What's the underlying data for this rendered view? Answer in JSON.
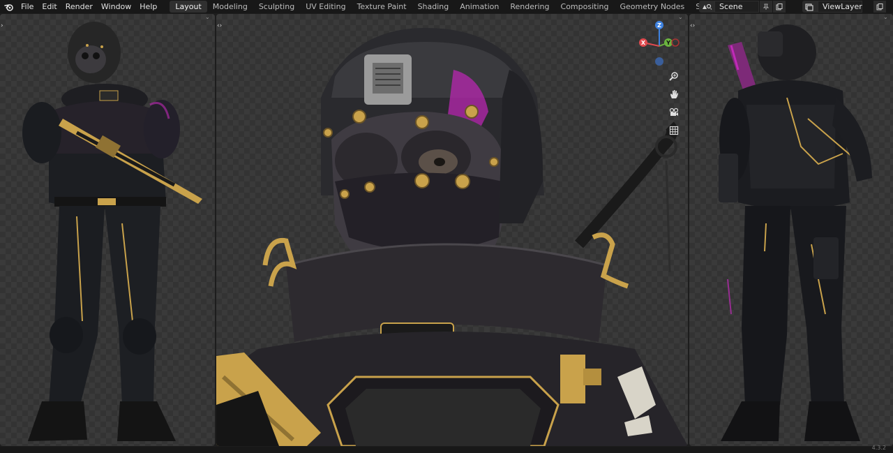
{
  "menu": [
    "File",
    "Edit",
    "Render",
    "Window",
    "Help"
  ],
  "workspaces": [
    {
      "label": "Layout",
      "active": true
    },
    {
      "label": "Modeling"
    },
    {
      "label": "Sculpting"
    },
    {
      "label": "UV Editing"
    },
    {
      "label": "Texture Paint"
    },
    {
      "label": "Shading"
    },
    {
      "label": "Animation"
    },
    {
      "label": "Rendering"
    },
    {
      "label": "Compositing"
    },
    {
      "label": "Geometry Nodes"
    },
    {
      "label": "Scripting"
    }
  ],
  "add_workspace": "+",
  "scene": {
    "label": "Scene"
  },
  "view_layer": {
    "label": "ViewLayer"
  },
  "gizmo": {
    "z": "Z",
    "y": "Y",
    "x": "X"
  },
  "status": {
    "version": "4.3.2"
  },
  "colors": {
    "accent": "#4772b3",
    "x_axis": "#e04a4f",
    "y_axis": "#6bb43f",
    "z_axis": "#3e82e0",
    "gold": "#c9a24b",
    "magenta": "#c02ab8"
  }
}
